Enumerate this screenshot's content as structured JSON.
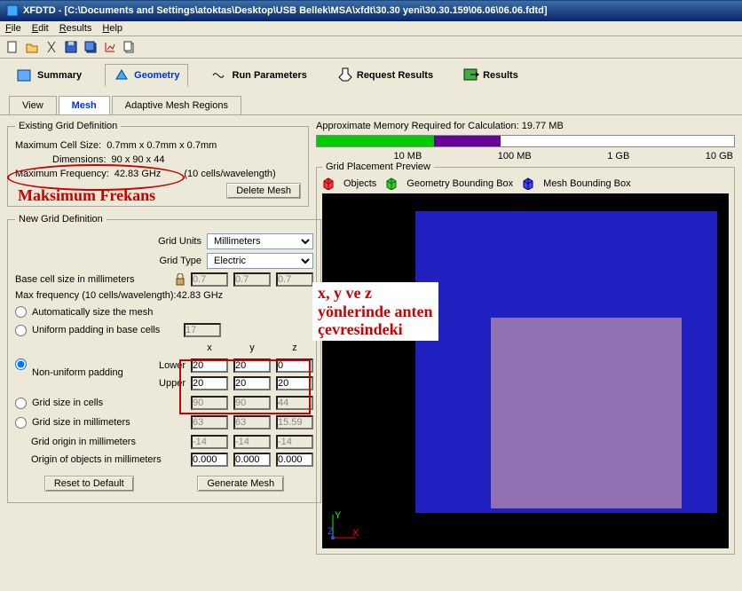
{
  "window": {
    "title": "XFDTD - [C:\\Documents and Settings\\atoktas\\Desktop\\USB Bellek\\MSA\\xfdt\\30.30 yeni\\30.30.159\\06.06\\06.06.fdtd]"
  },
  "menu": {
    "file": "File",
    "edit": "Edit",
    "results": "Results",
    "help": "Help"
  },
  "maintabs": {
    "summary": "Summary",
    "geometry": "Geometry",
    "run": "Run Parameters",
    "request": "Request Results",
    "results": "Results"
  },
  "subtabs": {
    "view": "View",
    "mesh": "Mesh",
    "adaptive": "Adaptive Mesh Regions"
  },
  "existing": {
    "legend": "Existing Grid Definition",
    "maxcell_label": "Maximum Cell Size:",
    "maxcell_value": "0.7mm x 0.7mm x 0.7mm",
    "dim_label": "Dimensions:",
    "dim_value": "90 x 90 x 44",
    "maxfreq_label": "Maximum Frequency:",
    "maxfreq_value": "42.83 GHz",
    "cells_note": "(10 cells/wavelength)",
    "delete_btn": "Delete Mesh"
  },
  "newgrid": {
    "legend": "New Grid Definition",
    "units_label": "Grid Units",
    "units_value": "Millimeters",
    "type_label": "Grid Type",
    "type_value": "Electric",
    "basecell_label": "Base cell size in millimeters",
    "basecell_x": "0.7",
    "basecell_y": "0.7",
    "basecell_z": "0.7",
    "maxfreq_text": "Max frequency (10 cells/wavelength):42.83 GHz",
    "auto_label": "Automatically size the mesh",
    "uniform_label": "Uniform padding in base cells",
    "uniform_val": "17",
    "nonuniform_label": "Non-uniform padding",
    "hdr_x": "x",
    "hdr_y": "y",
    "hdr_z": "z",
    "lower_label": "Lower",
    "lower_x": "20",
    "lower_y": "20",
    "lower_z": "0",
    "upper_label": "Upper",
    "upper_x": "20",
    "upper_y": "20",
    "upper_z": "20",
    "gridcells_label": "Grid size in cells",
    "gridcells_x": "90",
    "gridcells_y": "90",
    "gridcells_z": "44",
    "gridmm_label": "Grid size in millimeters",
    "gridmm_x": "63",
    "gridmm_y": "63",
    "gridmm_z": "15.59",
    "origin_label": "Grid origin in millimeters",
    "origin_x": "-14",
    "origin_y": "-14",
    "origin_z": "-14",
    "objorigin_label": "Origin of objects in millimeters",
    "objorigin_x": "0.000",
    "objorigin_y": "0.000",
    "objorigin_z": "0.000",
    "reset_btn": "Reset to Default",
    "generate_btn": "Generate Mesh"
  },
  "memory": {
    "label": "Approximate Memory Required for Calculation: 19.77 MB",
    "scale": {
      "t1": "10 MB",
      "t2": "100 MB",
      "t3": "1 GB",
      "t4": "10 GB"
    }
  },
  "preview": {
    "legend": "Grid Placement Preview",
    "objects": "Objects",
    "geobox": "Geometry Bounding Box",
    "meshbox": "Mesh Bounding Box"
  },
  "annotations": {
    "maksimum": "Maksimum Frekans",
    "xyz_note": "x, y ve z\nyönlerinde anten\nçevresindeki"
  }
}
